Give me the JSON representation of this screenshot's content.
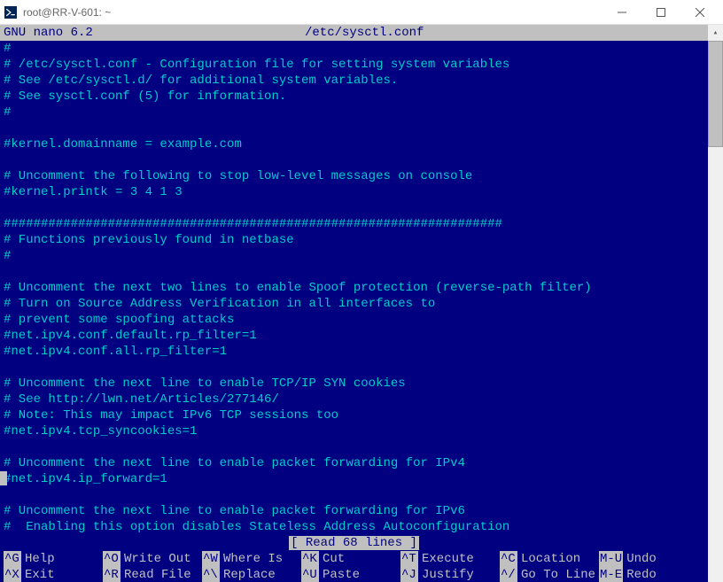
{
  "window": {
    "title": "root@RR-V-601: ~"
  },
  "nano": {
    "version": "GNU nano 6.2",
    "filename": "/etc/sysctl.conf",
    "status": "[ Read 68 lines ]"
  },
  "file_lines": [
    "#",
    "# /etc/sysctl.conf - Configuration file for setting system variables",
    "# See /etc/sysctl.d/ for additional system variables.",
    "# See sysctl.conf (5) for information.",
    "#",
    "",
    "#kernel.domainname = example.com",
    "",
    "# Uncomment the following to stop low-level messages on console",
    "#kernel.printk = 3 4 1 3",
    "",
    "###################################################################",
    "# Functions previously found in netbase",
    "#",
    "",
    "# Uncomment the next two lines to enable Spoof protection (reverse-path filter)",
    "# Turn on Source Address Verification in all interfaces to",
    "# prevent some spoofing attacks",
    "#net.ipv4.conf.default.rp_filter=1",
    "#net.ipv4.conf.all.rp_filter=1",
    "",
    "# Uncomment the next line to enable TCP/IP SYN cookies",
    "# See http://lwn.net/Articles/277146/",
    "# Note: This may impact IPv6 TCP sessions too",
    "#net.ipv4.tcp_syncookies=1",
    "",
    "# Uncomment the next line to enable packet forwarding for IPv4",
    "#net.ipv4.ip_forward=1",
    "",
    "# Uncomment the next line to enable packet forwarding for IPv6",
    "#  Enabling this option disables Stateless Address Autoconfiguration"
  ],
  "shortcuts_row1": [
    {
      "key": "^G",
      "label": "Help"
    },
    {
      "key": "^O",
      "label": "Write Out"
    },
    {
      "key": "^W",
      "label": "Where Is"
    },
    {
      "key": "^K",
      "label": "Cut"
    },
    {
      "key": "^T",
      "label": "Execute"
    },
    {
      "key": "^C",
      "label": "Location"
    },
    {
      "key": "M-U",
      "label": "Undo"
    }
  ],
  "shortcuts_row2": [
    {
      "key": "^X",
      "label": "Exit"
    },
    {
      "key": "^R",
      "label": "Read File"
    },
    {
      "key": "^\\",
      "label": "Replace"
    },
    {
      "key": "^U",
      "label": "Paste"
    },
    {
      "key": "^J",
      "label": "Justify"
    },
    {
      "key": "^/",
      "label": "Go To Line"
    },
    {
      "key": "M-E",
      "label": "Redo"
    }
  ]
}
